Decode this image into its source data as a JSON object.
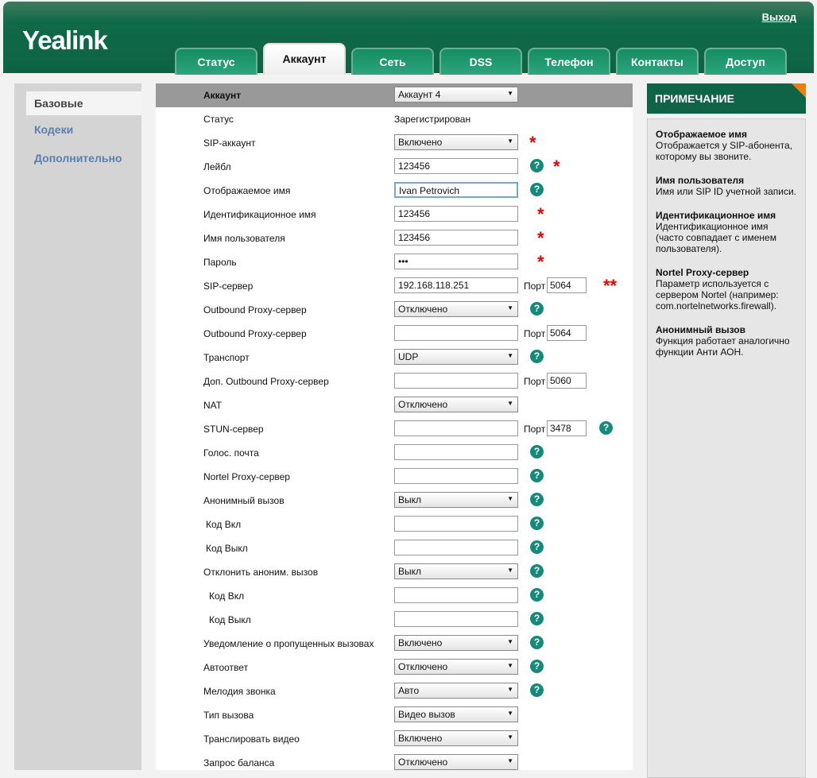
{
  "header": {
    "logo": "Yealink",
    "logout": "Выход",
    "tabs": [
      "Статус",
      "Аккаунт",
      "Сеть",
      "DSS",
      "Телефон",
      "Контакты",
      "Доступ"
    ],
    "active_tab": 1
  },
  "sidebar": {
    "items": [
      "Базовые",
      "Кодеки",
      "Дополнительно"
    ]
  },
  "rows": [
    {
      "label": "Аккаунт",
      "type": "select",
      "value": "Аккаунт 4",
      "head": true
    },
    {
      "label": "Статус",
      "type": "text",
      "value": "Зарегистрирован"
    },
    {
      "label": "SIP-аккаунт",
      "type": "select",
      "value": "Включено",
      "star": "*"
    },
    {
      "label": "Лейбл",
      "type": "input",
      "value": "123456",
      "help": true,
      "star": "*"
    },
    {
      "label": "Отображаемое имя",
      "type": "input",
      "value": "Ivan Petrovich",
      "help": true,
      "focus": true
    },
    {
      "label": "Идентификационное имя",
      "type": "input",
      "value": "123456",
      "star": "*"
    },
    {
      "label": "Имя пользователя",
      "type": "input",
      "value": "123456",
      "star": "*"
    },
    {
      "label": "Пароль",
      "type": "input",
      "value": "•••",
      "star": "*"
    },
    {
      "label": "SIP-сервер",
      "type": "input",
      "value": "192.168.118.251",
      "port_label": "Порт",
      "port": "5064",
      "star": "**"
    },
    {
      "label": "Outbound Proxy-сервер",
      "type": "select",
      "value": "Отключено",
      "help": true
    },
    {
      "label": "Outbound Proxy-сервер",
      "type": "input",
      "value": "",
      "port_label": "Порт",
      "port": "5064"
    },
    {
      "label": "Транспорт",
      "type": "select",
      "value": "UDP",
      "help": true
    },
    {
      "label": "Доп. Outbound Proxy-сервер",
      "type": "input",
      "value": "",
      "port_label": "Порт",
      "port": "5060"
    },
    {
      "label": "NAT",
      "type": "select",
      "value": "Отключено"
    },
    {
      "label": "STUN-сервер",
      "type": "input",
      "value": "",
      "port_label": "Порт",
      "port": "3478",
      "help_far": true
    },
    {
      "label": "Голос. почта",
      "type": "input",
      "value": "",
      "help": true
    },
    {
      "label": "Nortel Proxy-сервер",
      "type": "input",
      "value": "",
      "help": true
    },
    {
      "label": "Анонимный вызов",
      "type": "select",
      "value": "Выкл",
      "help": true
    },
    {
      "label": " Код Вкл",
      "type": "input",
      "value": "",
      "help": true,
      "indent": 1
    },
    {
      "label": " Код Выкл",
      "type": "input",
      "value": "",
      "help": true,
      "indent": 1
    },
    {
      "label": "Отклонить аноним. вызов",
      "type": "select",
      "value": "Выкл",
      "help": true
    },
    {
      "label": "Код Вкл",
      "type": "input",
      "value": "",
      "help": true,
      "indent": 2
    },
    {
      "label": "Код Выкл",
      "type": "input",
      "value": "",
      "help": true,
      "indent": 2
    },
    {
      "label": "Уведомление о пропущенных вызовах",
      "type": "select",
      "value": "Включено",
      "help": true
    },
    {
      "label": "Автоответ",
      "type": "select",
      "value": "Отключено",
      "help": true
    },
    {
      "label": "Мелодия звонка",
      "type": "select",
      "value": "Авто",
      "help": true
    },
    {
      "label": "Тип вызова",
      "type": "select",
      "value": "Видео вызов"
    },
    {
      "label": "Транслировать видео",
      "type": "select",
      "value": "Включено"
    },
    {
      "label": "Запрос баланса",
      "type": "select",
      "value": "Отключено"
    }
  ],
  "note": {
    "title": "ПРИМЕЧАНИЕ",
    "items": [
      {
        "title": "Отображаемое имя",
        "text": "Отображается у SIP-абонента, которому вы звоните."
      },
      {
        "title": "Имя пользователя",
        "text": "Имя или SIP ID учетной записи."
      },
      {
        "title": "Идентификационное имя",
        "text": "Идентификационное имя (часто совпадает с именем пользователя)."
      },
      {
        "title": "Nortel Proxy-сервер",
        "text": "Параметр используется с сервером Nortel (например: com.nortelnetworks.firewall)."
      },
      {
        "title": "Анонимный вызов",
        "text": "Функция работает аналогично функции Анти АОН."
      }
    ]
  }
}
